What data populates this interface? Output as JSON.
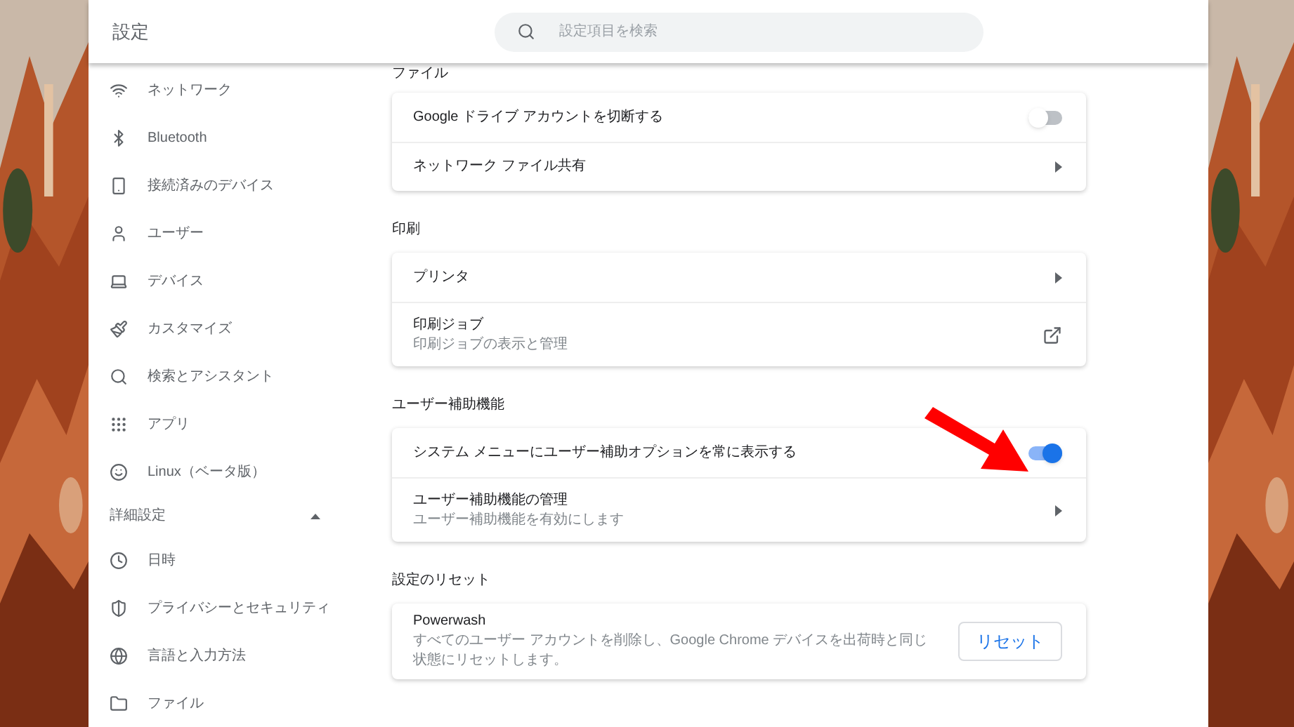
{
  "window": {
    "title": "設定"
  },
  "search": {
    "placeholder": "設定項目を検索"
  },
  "sidebar": {
    "items": [
      {
        "label": "ネットワーク"
      },
      {
        "label": "Bluetooth"
      },
      {
        "label": "接続済みのデバイス"
      },
      {
        "label": "ユーザー"
      },
      {
        "label": "デバイス"
      },
      {
        "label": "カスタマイズ"
      },
      {
        "label": "検索とアシスタント"
      },
      {
        "label": "アプリ"
      },
      {
        "label": "Linux（ベータ版）"
      }
    ],
    "advanced": {
      "label": "詳細設定",
      "expanded": true,
      "items": [
        {
          "label": "日時"
        },
        {
          "label": "プライバシーとセキュリティ"
        },
        {
          "label": "言語と入力方法"
        },
        {
          "label": "ファイル"
        }
      ]
    }
  },
  "sections": [
    {
      "title": "ファイル",
      "rows": [
        {
          "kind": "toggle",
          "label": "Google ドライブ アカウントを切断する",
          "on": false
        },
        {
          "kind": "link",
          "label": "ネットワーク ファイル共有"
        }
      ]
    },
    {
      "title": "印刷",
      "rows": [
        {
          "kind": "link",
          "label": "プリンタ"
        },
        {
          "kind": "external",
          "label": "印刷ジョブ",
          "sublabel": "印刷ジョブの表示と管理"
        }
      ]
    },
    {
      "title": "ユーザー補助機能",
      "rows": [
        {
          "kind": "toggle",
          "label": "システム メニューにユーザー補助オプションを常に表示する",
          "on": true
        },
        {
          "kind": "link",
          "label": "ユーザー補助機能の管理",
          "sublabel": "ユーザー補助機能を有効にします"
        }
      ]
    },
    {
      "title": "設定のリセット",
      "rows": [
        {
          "kind": "button",
          "label": "Powerwash",
          "sublabel": "すべてのユーザー アカウントを削除し、Google Chrome デバイスを出荷時と同じ状態にリセットします。",
          "button": "リセット"
        }
      ]
    }
  ]
}
